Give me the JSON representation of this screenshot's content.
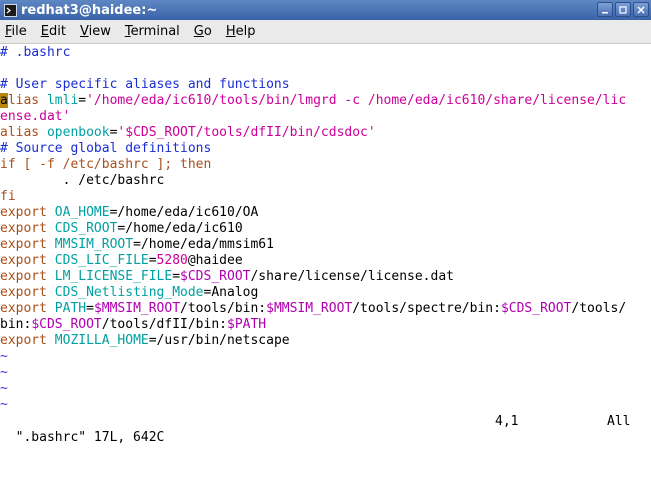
{
  "window": {
    "title": "redhat3@haidee:~",
    "buttons": [
      "minimize-icon",
      "maximize-icon",
      "close-icon"
    ]
  },
  "menu": {
    "items": [
      {
        "mnemonic": "F",
        "rest": "ile"
      },
      {
        "mnemonic": "E",
        "rest": "dit"
      },
      {
        "mnemonic": "V",
        "rest": "iew"
      },
      {
        "mnemonic": "T",
        "rest": "erminal"
      },
      {
        "mnemonic": "G",
        "rest": "o"
      },
      {
        "mnemonic": "H",
        "rest": "elp"
      }
    ]
  },
  "colors": {
    "comment": "#1a2ed4",
    "keyword": "#a6501c",
    "string": "#cc0099",
    "variable": "#b000b0",
    "identifier": "#00a0a0",
    "cursor": "#b8860b"
  },
  "lines": [
    [
      {
        "t": "# .bashrc",
        "c": "comment"
      }
    ],
    [
      {
        "t": "",
        "c": ""
      }
    ],
    [
      {
        "t": "# User specific aliases and functions",
        "c": "comment"
      }
    ],
    [
      {
        "t": "a",
        "c": "cursor"
      },
      {
        "t": "lias",
        "c": "keyword"
      },
      {
        "t": " ",
        "c": ""
      },
      {
        "t": "lmli",
        "c": "ident"
      },
      {
        "t": "=",
        "c": ""
      },
      {
        "t": "'/home/eda/ic610/tools/bin/lmgrd -c /home/eda/ic610/share/license/lic",
        "c": "string"
      }
    ],
    [
      {
        "t": "ense.dat'",
        "c": "string"
      }
    ],
    [
      {
        "t": "alias",
        "c": "keyword"
      },
      {
        "t": " ",
        "c": ""
      },
      {
        "t": "openbook",
        "c": "ident"
      },
      {
        "t": "=",
        "c": ""
      },
      {
        "t": "'$CDS_ROOT/tools/dfII/bin/cdsdoc'",
        "c": "string"
      }
    ],
    [
      {
        "t": "# Source global definitions",
        "c": "comment"
      }
    ],
    [
      {
        "t": "if",
        "c": "keyword"
      },
      {
        "t": " [ -f /etc/bashrc ]; ",
        "c": "keyword"
      },
      {
        "t": "then",
        "c": "keyword"
      }
    ],
    [
      {
        "t": "        . /etc/bashrc",
        "c": ""
      }
    ],
    [
      {
        "t": "fi",
        "c": "keyword"
      }
    ],
    [
      {
        "t": "export",
        "c": "keyword"
      },
      {
        "t": " ",
        "c": ""
      },
      {
        "t": "OA_HOME",
        "c": "ident"
      },
      {
        "t": "=/home/eda/ic610/OA",
        "c": ""
      }
    ],
    [
      {
        "t": "export",
        "c": "keyword"
      },
      {
        "t": " ",
        "c": ""
      },
      {
        "t": "CDS_ROOT",
        "c": "ident"
      },
      {
        "t": "=/home/eda/ic610",
        "c": ""
      }
    ],
    [
      {
        "t": "export",
        "c": "keyword"
      },
      {
        "t": " ",
        "c": ""
      },
      {
        "t": "MMSIM_ROOT",
        "c": "ident"
      },
      {
        "t": "=/home/eda/mmsim61",
        "c": ""
      }
    ],
    [
      {
        "t": "export",
        "c": "keyword"
      },
      {
        "t": " ",
        "c": ""
      },
      {
        "t": "CDS_LIC_FILE",
        "c": "ident"
      },
      {
        "t": "=",
        "c": ""
      },
      {
        "t": "5280",
        "c": "string"
      },
      {
        "t": "@haidee",
        "c": ""
      }
    ],
    [
      {
        "t": "export",
        "c": "keyword"
      },
      {
        "t": " ",
        "c": ""
      },
      {
        "t": "LM_LICENSE_FILE",
        "c": "ident"
      },
      {
        "t": "=",
        "c": ""
      },
      {
        "t": "$CDS_ROOT",
        "c": "var"
      },
      {
        "t": "/share/license/license.dat",
        "c": ""
      }
    ],
    [
      {
        "t": "export",
        "c": "keyword"
      },
      {
        "t": " ",
        "c": ""
      },
      {
        "t": "CDS_Netlisting_Mode",
        "c": "ident"
      },
      {
        "t": "=Analog",
        "c": ""
      }
    ],
    [
      {
        "t": "export",
        "c": "keyword"
      },
      {
        "t": " ",
        "c": ""
      },
      {
        "t": "PATH",
        "c": "ident"
      },
      {
        "t": "=",
        "c": ""
      },
      {
        "t": "$MMSIM_ROOT",
        "c": "var"
      },
      {
        "t": "/tools/bin:",
        "c": ""
      },
      {
        "t": "$MMSIM_ROOT",
        "c": "var"
      },
      {
        "t": "/tools/spectre/bin:",
        "c": ""
      },
      {
        "t": "$CDS_ROOT",
        "c": "var"
      },
      {
        "t": "/tools/",
        "c": ""
      }
    ],
    [
      {
        "t": "bin:",
        "c": ""
      },
      {
        "t": "$CDS_ROOT",
        "c": "var"
      },
      {
        "t": "/tools/dfII/bin:",
        "c": ""
      },
      {
        "t": "$PATH",
        "c": "var"
      }
    ],
    [
      {
        "t": "export",
        "c": "keyword"
      },
      {
        "t": " ",
        "c": ""
      },
      {
        "t": "MOZILLA_HOME",
        "c": "ident"
      },
      {
        "t": "=/usr/bin/netscape",
        "c": ""
      }
    ],
    [
      {
        "t": "~",
        "c": "tilde"
      }
    ],
    [
      {
        "t": "~",
        "c": "tilde"
      }
    ],
    [
      {
        "t": "~",
        "c": "tilde"
      }
    ],
    [
      {
        "t": "~",
        "c": "tilde"
      }
    ]
  ],
  "status": {
    "file": "\".bashrc\" 17L, 642C",
    "position": "4,1",
    "scroll": "All"
  }
}
